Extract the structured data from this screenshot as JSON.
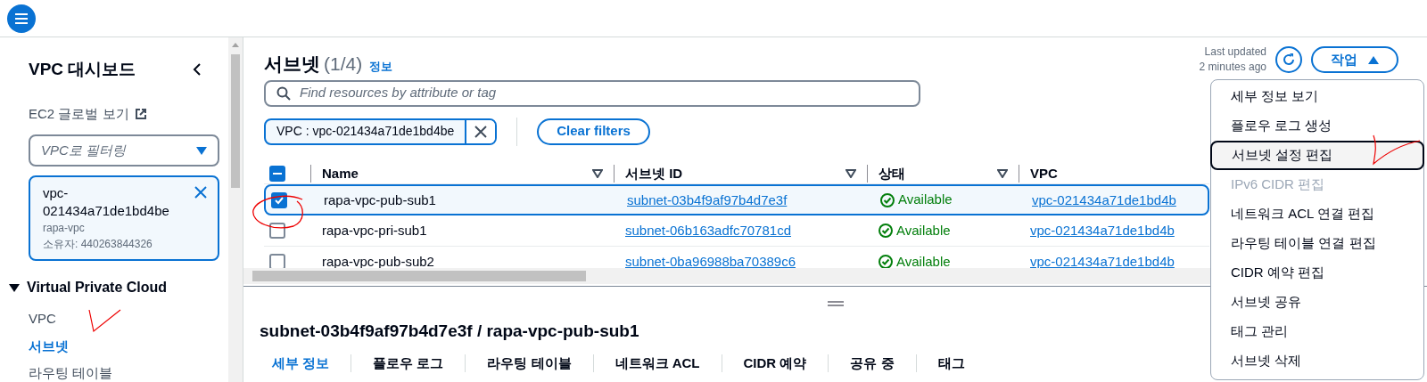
{
  "sidebar": {
    "title": "VPC 대시보드",
    "ec2_link": "EC2 글로벌 보기",
    "vpc_filter": {
      "placeholder": "VPC로 필터링"
    },
    "selected_vpc": {
      "id": "vpc-021434a71de1bd4be",
      "name": "rapa-vpc",
      "owner": "소유자: 440263844326"
    },
    "section": {
      "title": "Virtual Private Cloud",
      "expanded": true,
      "items": [
        {
          "label": "VPC",
          "selected": false
        },
        {
          "label": "서브넷",
          "selected": true
        },
        {
          "label": "라우팅 테이블",
          "selected": false
        }
      ]
    }
  },
  "main": {
    "title": "서브넷",
    "count": "(1/4)",
    "info": "정보",
    "last_updated": [
      "Last updated",
      "2 minutes ago"
    ],
    "actions": {
      "label": "작업",
      "expanded": true
    },
    "search": {
      "placeholder": "Find resources by attribute or tag"
    },
    "filter_token": "VPC : vpc-021434a71de1bd4be",
    "clear_filters": "Clear filters",
    "table": {
      "select_all_indeterminate": true,
      "columns": [
        "Name",
        "서브넷 ID",
        "상태",
        "VPC"
      ],
      "rows": [
        {
          "selected": true,
          "name": "rapa-vpc-pub-sub1",
          "subnet_id": "subnet-03b4f9af97b4d7e3f",
          "status": "Available",
          "vpc": "vpc-021434a71de1bd4b"
        },
        {
          "selected": false,
          "name": "rapa-vpc-pri-sub1",
          "subnet_id": "subnet-06b163adfc70781cd",
          "status": "Available",
          "vpc": "vpc-021434a71de1bd4b"
        },
        {
          "selected": false,
          "name": "rapa-vpc-pub-sub2",
          "subnet_id": "subnet-0ba96988ba70389c6",
          "status": "Available",
          "vpc": "vpc-021434a71de1bd4b"
        }
      ]
    }
  },
  "actions_menu": [
    {
      "label": "세부 정보 보기",
      "disabled": false,
      "focused": false
    },
    {
      "label": "플로우 로그 생성",
      "disabled": false,
      "focused": false
    },
    {
      "label": "서브넷 설정 편집",
      "disabled": false,
      "focused": true
    },
    {
      "label": "IPv6 CIDR 편집",
      "disabled": true,
      "focused": false
    },
    {
      "label": "네트워크 ACL 연결 편집",
      "disabled": false,
      "focused": false
    },
    {
      "label": "라우팅 테이블 연결 편집",
      "disabled": false,
      "focused": false
    },
    {
      "label": "CIDR 예약 편집",
      "disabled": false,
      "focused": false
    },
    {
      "label": "서브넷 공유",
      "disabled": false,
      "focused": false
    },
    {
      "label": "태그 관리",
      "disabled": false,
      "focused": false
    },
    {
      "label": "서브넷 삭제",
      "disabled": false,
      "focused": false
    }
  ],
  "detail": {
    "title": "subnet-03b4f9af97b4d7e3f / rapa-vpc-pub-sub1",
    "tabs": [
      {
        "label": "세부 정보",
        "selected": true
      },
      {
        "label": "플로우 로그",
        "selected": false
      },
      {
        "label": "라우팅 테이블",
        "selected": false
      },
      {
        "label": "네트워크 ACL",
        "selected": false
      },
      {
        "label": "CIDR 예약",
        "selected": false
      },
      {
        "label": "공유 중",
        "selected": false
      },
      {
        "label": "태그",
        "selected": false
      }
    ]
  }
}
